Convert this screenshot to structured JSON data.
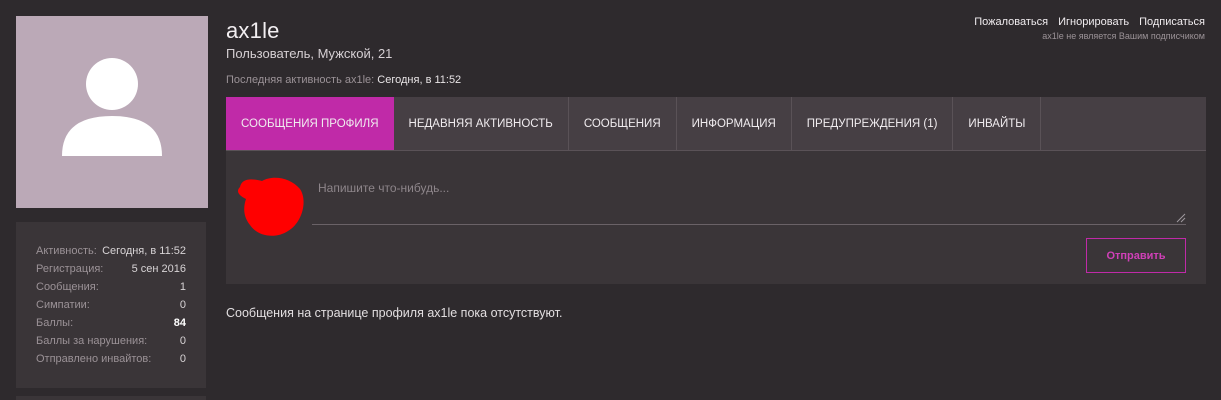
{
  "profile": {
    "username": "ax1le",
    "meta": "Пользователь, Мужской, 21",
    "last_activity_label": "Последняя активность ax1le:",
    "last_activity_value": "Сегодня, в 11:52"
  },
  "actions": {
    "report": "Пожаловаться",
    "ignore": "Игнорировать",
    "follow": "Подписаться",
    "not_following_note": "ax1le не является Вашим подписчиком"
  },
  "tabs": [
    {
      "label": "СООБЩЕНИЯ ПРОФИЛЯ",
      "active": true
    },
    {
      "label": "НЕДАВНЯЯ АКТИВНОСТЬ",
      "active": false
    },
    {
      "label": "СООБЩЕНИЯ",
      "active": false
    },
    {
      "label": "ИНФОРМАЦИЯ",
      "active": false
    },
    {
      "label": "ПРЕДУПРЕЖДЕНИЯ (1)",
      "active": false
    },
    {
      "label": "ИНВАЙТЫ",
      "active": false
    }
  ],
  "post": {
    "placeholder": "Напишите что-нибудь...",
    "submit_label": "Отправить"
  },
  "empty_message": "Сообщения на странице профиля ax1le пока отсутствуют.",
  "stats": [
    {
      "key": "Активность:",
      "value": "Сегодня, в 11:52",
      "bold": false
    },
    {
      "key": "Регистрация:",
      "value": "5 сен 2016",
      "bold": false
    },
    {
      "key": "Сообщения:",
      "value": "1",
      "bold": false
    },
    {
      "key": "Симпатии:",
      "value": "0",
      "bold": false
    },
    {
      "key": "Баллы:",
      "value": "84",
      "bold": true
    },
    {
      "key": "Баллы за нарушения:",
      "value": "0",
      "bold": false
    },
    {
      "key": "Отправлено инвайтов:",
      "value": "0",
      "bold": false
    }
  ],
  "colors": {
    "accent": "#c02aa8",
    "background": "#2e2a2d",
    "panel": "#3a3538",
    "tab_bar": "#463f44",
    "avatar_bg": "#bba9b7",
    "scribble": "#ff0000"
  },
  "icons": {
    "avatar": "default-user-silhouette-icon",
    "scribble": "red-scribble-redaction",
    "resize": "textarea-resize-grip-icon"
  }
}
